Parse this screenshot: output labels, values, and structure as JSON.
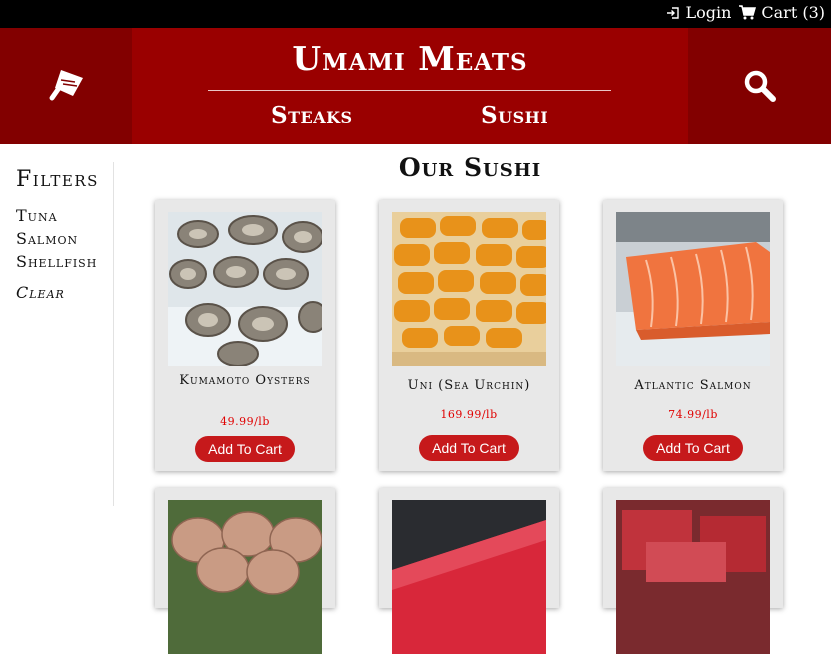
{
  "topbar": {
    "login_label": "Login",
    "cart_label": "Cart (3)"
  },
  "header": {
    "brand": "Umami Meats",
    "nav": [
      {
        "label": "Steaks"
      },
      {
        "label": "Sushi"
      }
    ],
    "left_icon": "cleaver-icon",
    "right_icon": "search-icon"
  },
  "sidebar": {
    "title": "Filters",
    "items": [
      {
        "label": "Tuna"
      },
      {
        "label": "Salmon"
      },
      {
        "label": "Shellfish"
      }
    ],
    "clear_label": "Clear"
  },
  "main": {
    "title": "Our Sushi",
    "products": [
      {
        "name": "Kumamoto Oysters",
        "price": "49.99/lb",
        "button": "Add To Cart",
        "image": "oysters-on-ice"
      },
      {
        "name": "Uni (Sea Urchin)",
        "price": "169.99/lb",
        "button": "Add To Cart",
        "image": "sea-urchin-tray"
      },
      {
        "name": "Atlantic Salmon",
        "price": "74.99/lb",
        "button": "Add To Cart",
        "image": "salmon-fillet-on-ice"
      },
      {
        "image": "scallops-on-seaweed"
      },
      {
        "image": "tuna-block"
      },
      {
        "image": "tuna-chunks"
      }
    ]
  },
  "colors": {
    "header_bg": "#9a0000",
    "header_side_bg": "#820000",
    "button_bg": "#c6191b",
    "price": "#e00000",
    "topbar_bg": "#000000"
  }
}
